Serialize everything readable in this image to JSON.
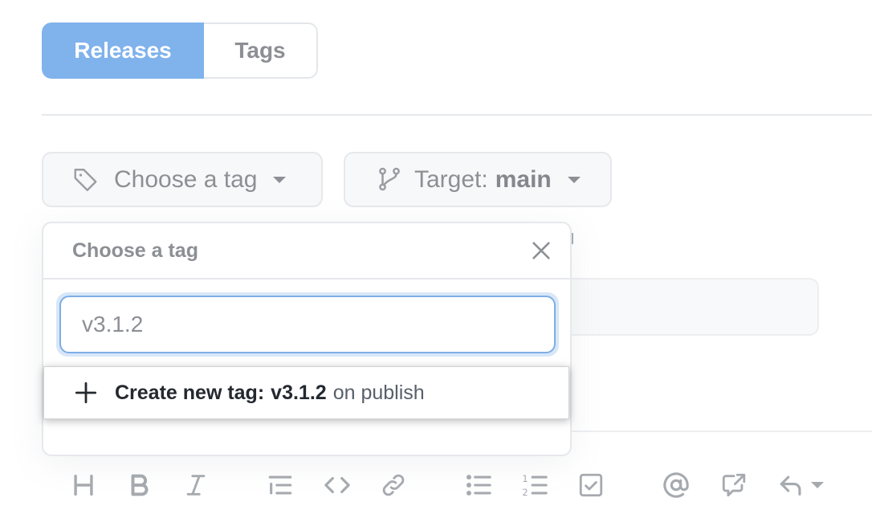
{
  "tabs": [
    {
      "label": "Releases",
      "active": true
    },
    {
      "label": "Tags",
      "active": false
    }
  ],
  "tag_select": {
    "label": "Choose a tag",
    "icon": "tag-icon"
  },
  "target_select": {
    "prefix": "Target:",
    "value": "main",
    "icon": "git-branch-icon"
  },
  "popover": {
    "title": "Choose a tag",
    "close_icon": "x-icon",
    "filter_value": "v3.1.2",
    "create_item": {
      "icon": "plus-icon",
      "label": "Create new tag:",
      "tag": "v3.1.2",
      "suffix": "on publish"
    }
  },
  "toolbar": [
    {
      "name": "heading",
      "icon": "heading-icon"
    },
    {
      "name": "bold",
      "icon": "bold-icon"
    },
    {
      "name": "italic",
      "icon": "italic-icon"
    },
    {
      "name": "quote",
      "icon": "quote-icon"
    },
    {
      "name": "code",
      "icon": "code-icon"
    },
    {
      "name": "link",
      "icon": "link-icon"
    },
    {
      "name": "unordered-list",
      "icon": "list-unordered-icon"
    },
    {
      "name": "ordered-list",
      "icon": "list-ordered-icon"
    },
    {
      "name": "task-list",
      "icon": "tasklist-icon"
    },
    {
      "name": "mention",
      "icon": "mention-icon"
    },
    {
      "name": "reference",
      "icon": "cross-reference-icon"
    },
    {
      "name": "saved-replies",
      "icon": "reply-icon"
    }
  ],
  "colors": {
    "accent": "#80b2ec",
    "focus_ring": "#7eaee6",
    "muted_text": "#8c8f94",
    "border": "#e6e8eb"
  }
}
